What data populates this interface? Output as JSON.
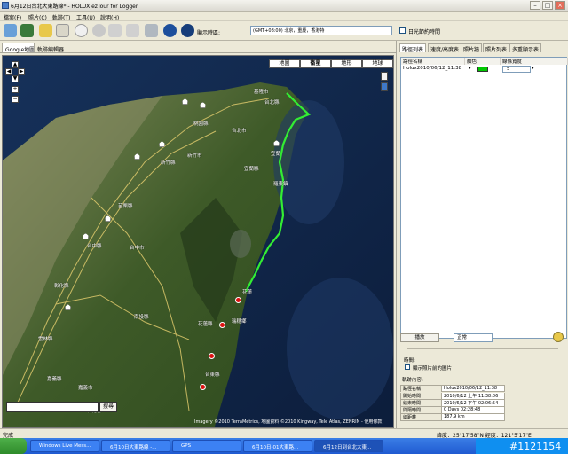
{
  "window": {
    "title": "6月12日台北大東路線* - HOLUX ezTour for Logger"
  },
  "menu": [
    "檔案(F)",
    "照片(C)",
    "軌跡(T)",
    "工具(U)",
    "說明(H)"
  ],
  "toolbar": {
    "timezone_label": "顯示時區:",
    "timezone_value": "(GMT+08:00) 北京，重慶，香港特",
    "dst_label": "日光節約時間",
    "icons": [
      "open-icon",
      "save-icon",
      "folder-icon",
      "photo-icon",
      "clock-icon",
      "globe-icon",
      "flickr-icon",
      "locr-icon",
      "blog-icon",
      "earth-icon",
      "earth2-icon"
    ]
  },
  "map_tabs": [
    "Google地圖",
    "軌跡編輯器"
  ],
  "map": {
    "types": [
      "地圖",
      "衛星",
      "地形",
      "地球"
    ],
    "active_type": "衛星",
    "search_button": "搜尋",
    "copyright": "Imagery ©2010 TerraMetrics, 地圖資料 ©2010 Kingway, Tele Atlas, ZENRIN - 使用條款",
    "labels": [
      "基隆市",
      "台北縣",
      "台北市",
      "桃園縣",
      "新竹縣",
      "苗栗縣",
      "台中縣",
      "台中市",
      "彰化縣",
      "雲林縣",
      "嘉義縣",
      "台南縣",
      "南投縣",
      "花蓮縣",
      "宜蘭縣",
      "嘉義市",
      "台東縣",
      "宜蘭",
      "花蓮",
      "瑞穗鄉",
      "新竹市",
      "羅東鎮"
    ]
  },
  "right_tabs": [
    "路徑列表",
    "速度/高度表",
    "照片牆",
    "照片列表",
    "多重顯示表"
  ],
  "track_table": {
    "headers": [
      "路徑名稱",
      "顏色",
      "線條寬度"
    ],
    "rows": [
      {
        "name": "Holux2010/06/12_11:38",
        "color": "#00c800",
        "width": "5"
      }
    ]
  },
  "playback": {
    "button": "播放",
    "speed": "正常",
    "time_label": "時間:",
    "show_photo_label": "顯示照片前的圖片",
    "info_label": "軌跡內容:"
  },
  "track_info": [
    {
      "key": "路徑名稱",
      "value": "Holux2010/06/12_11:38"
    },
    {
      "key": "開始時間",
      "value": "2010/6/12 上午 11:38:06"
    },
    {
      "key": "結束時間",
      "value": "2010/6/12 下午 02:06:54"
    },
    {
      "key": "間隔時間",
      "value": "0 Days 02:28:48"
    },
    {
      "key": "總距離",
      "value": "187.9 km"
    }
  ],
  "statusbar": {
    "left": "完成",
    "right": "緯度：25°17'58\"N  經度：121°5'17\"E"
  },
  "taskbar": {
    "tasks": [
      "Windows Live Mess...",
      "6月10日大東路線 -...",
      "GPS",
      "6月10日-01大東路...",
      "6月12日到台北大東..."
    ],
    "watermark": "#1121154"
  },
  "colors": {
    "track": "#33ee33",
    "window_bg": "#ece9d8",
    "taskbar": "#245edb"
  }
}
